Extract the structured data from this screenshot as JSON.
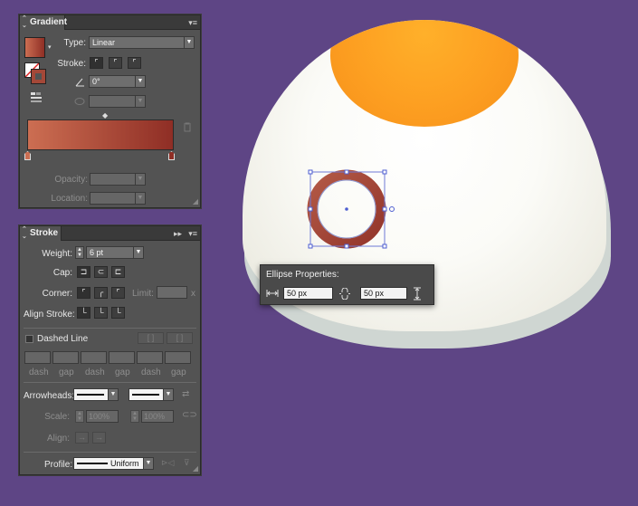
{
  "gradient_panel": {
    "title": "Gradient",
    "type_label": "Type:",
    "type_value": "Linear",
    "stroke_label": "Stroke:",
    "angle_value": "0°",
    "opacity_label": "Opacity:",
    "location_label": "Location:",
    "colors": {
      "start": "#cc6e52",
      "end": "#8f2e25"
    }
  },
  "stroke_panel": {
    "title": "Stroke",
    "weight_label": "Weight:",
    "weight_value": "6 pt",
    "cap_label": "Cap:",
    "corner_label": "Corner:",
    "limit_label": "Limit:",
    "limit_unit": "x",
    "align_label": "Align Stroke:",
    "dashed_label": "Dashed Line",
    "dash_labels": [
      "dash",
      "gap",
      "dash",
      "gap",
      "dash",
      "gap"
    ],
    "arrowheads_label": "Arrowheads:",
    "scale_label": "Scale:",
    "scale_start": "100%",
    "scale_end": "100%",
    "align_arrow_label": "Align:",
    "profile_label": "Profile:",
    "profile_value": "Uniform"
  },
  "ellipse_properties": {
    "title": "Ellipse Properties:",
    "width_value": "50 px",
    "height_value": "50 px"
  },
  "canvas": {
    "background": "#5e4585",
    "ring_color": "#a64a3b"
  }
}
